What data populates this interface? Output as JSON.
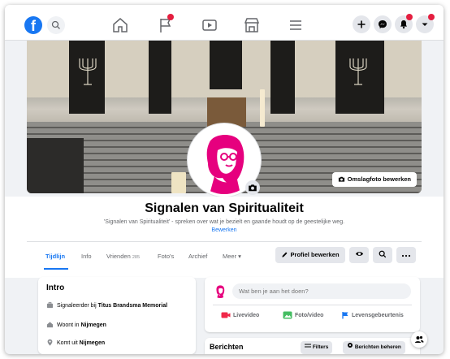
{
  "topbar": {
    "logo_text": "f",
    "icons": [
      "search-icon",
      "home-icon",
      "flag-icon",
      "video-icon",
      "marketplace-icon",
      "menu-icon",
      "plus-icon",
      "messenger-icon",
      "bell-icon",
      "chevron-down-icon"
    ],
    "badge_color": "#e41e3f"
  },
  "cover": {
    "edit_label": "Omslagfoto bewerken"
  },
  "profile": {
    "name": "Signalen van Spiritualiteit",
    "subtitle": "'Signalen van Spiritualiteit' - spreken over wat je bezielt en gaande houdt op de geestelijke weg.",
    "edit_link": "Bewerken",
    "accent_color": "#e6007e"
  },
  "tabs": [
    {
      "label": "Tijdlijn",
      "active": true
    },
    {
      "label": "Info"
    },
    {
      "label": "Vrienden",
      "count": "285"
    },
    {
      "label": "Foto's"
    },
    {
      "label": "Archief"
    },
    {
      "label": "Meer ▾"
    }
  ],
  "actions": {
    "edit_profile": "Profiel bewerken"
  },
  "intro": {
    "title": "Intro",
    "rows": [
      {
        "prefix": "Signaleerder bij ",
        "strong": "Titus Brandsma Memorial"
      },
      {
        "prefix": "Woont in ",
        "strong": "Nijmegen"
      },
      {
        "prefix": "Komt uit ",
        "strong": "Nijmegen"
      }
    ]
  },
  "composer": {
    "placeholder": "Wat ben je aan het doen?",
    "buttons": [
      "Livevideo",
      "Foto/video",
      "Levensgebeurtenis"
    ]
  },
  "posts": {
    "title": "Berichten",
    "filters": "Filters",
    "manage": "Berichten beheren"
  }
}
